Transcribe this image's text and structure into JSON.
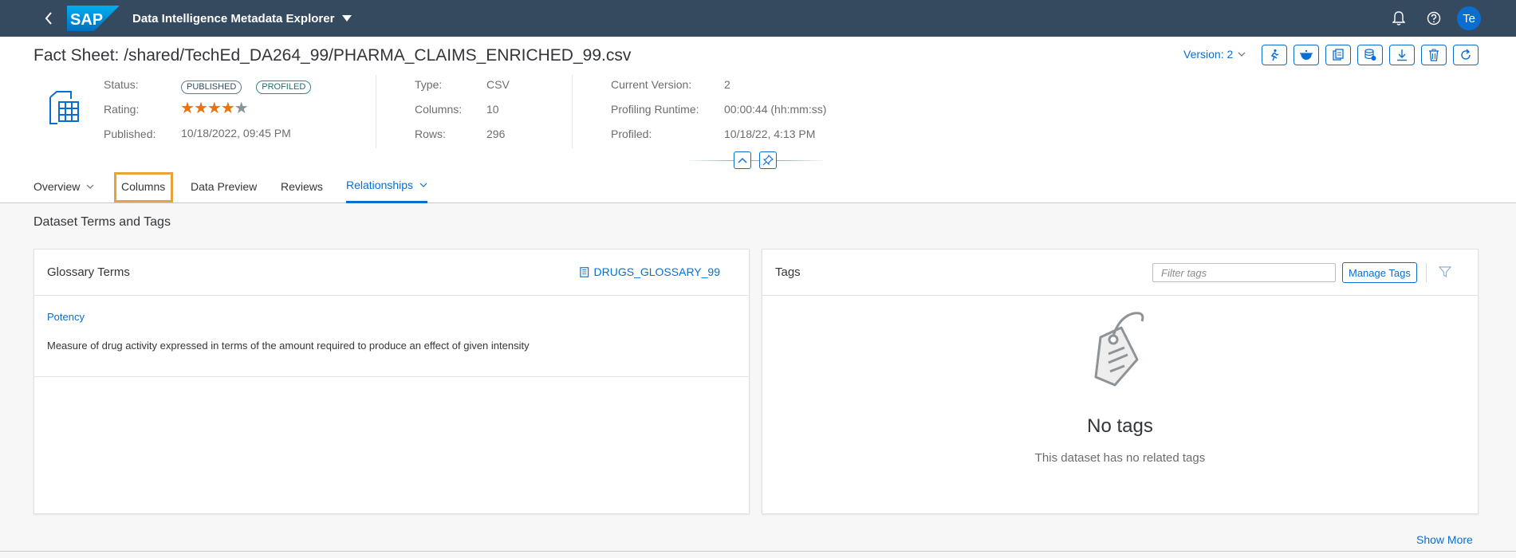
{
  "shell": {
    "app_title": "Data Intelligence Metadata Explorer",
    "avatar_initials": "Te",
    "logo_text": "SAP",
    "icons": [
      "back-icon",
      "bell-icon",
      "help-icon"
    ]
  },
  "header": {
    "title": "Fact Sheet: /shared/TechEd_DA264_99/PHARMA_CLAIMS_ENRICHED_99.csv",
    "version_label": "Version: 2",
    "action_icons": [
      "run-profile-icon",
      "lineage-icon",
      "copy-icon",
      "publish-icon",
      "download-icon",
      "delete-icon",
      "refresh-icon"
    ],
    "status_label": "Status:",
    "status_badges": [
      "PUBLISHED",
      "PROFILED"
    ],
    "rating_label": "Rating:",
    "rating_value": 4,
    "rating_max": 5,
    "published_label": "Published:",
    "published_value": "10/18/2022, 09:45 PM",
    "type_label": "Type:",
    "type_value": "CSV",
    "columns_label": "Columns:",
    "columns_value": "10",
    "rows_label": "Rows:",
    "rows_value": "296",
    "current_version_label": "Current Version:",
    "current_version_value": "2",
    "profiling_runtime_label": "Profiling Runtime:",
    "profiling_runtime_value": "00:00:44 (hh:mm:ss)",
    "profiled_label": "Profiled:",
    "profiled_value": "10/18/22, 4:13 PM"
  },
  "tabs": [
    {
      "label": "Overview",
      "dropdown": true
    },
    {
      "label": "Columns",
      "dropdown": false,
      "highlighted": true
    },
    {
      "label": "Data Preview",
      "dropdown": false
    },
    {
      "label": "Reviews",
      "dropdown": false
    },
    {
      "label": "Relationships",
      "dropdown": true,
      "active": true
    }
  ],
  "section": {
    "title": "Dataset Terms and Tags"
  },
  "glossary": {
    "title": "Glossary Terms",
    "glossary_link": "DRUGS_GLOSSARY_99",
    "terms": [
      {
        "name": "Potency",
        "description": "Measure of drug activity expressed in terms of the amount required to produce an effect of given intensity"
      }
    ]
  },
  "tags": {
    "title": "Tags",
    "filter_placeholder": "Filter tags",
    "manage_button": "Manage Tags",
    "empty_title": "No tags",
    "empty_subtitle": "This dataset has no related tags"
  },
  "footer": {
    "show_more": "Show More"
  },
  "colors": {
    "shell_bg": "#354a5f",
    "accent": "#0a6ed1",
    "highlight": "#e8a33a",
    "rating_star": "#e9730c"
  }
}
